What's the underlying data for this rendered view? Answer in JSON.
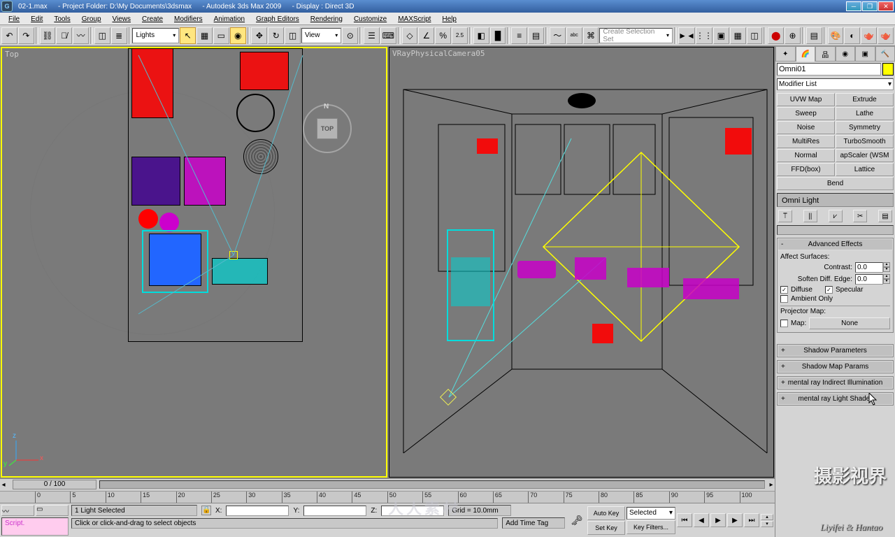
{
  "title": {
    "filename": "02-1.max",
    "project": "- Project Folder: D:\\My Documents\\3dsmax",
    "app": "- Autodesk 3ds Max  2009",
    "display": "- Display : Direct 3D"
  },
  "menu": [
    "File",
    "Edit",
    "Tools",
    "Group",
    "Views",
    "Create",
    "Modifiers",
    "Animation",
    "Graph Editors",
    "Rendering",
    "Customize",
    "MAXScript",
    "Help"
  ],
  "toolbar": {
    "category_dropdown": "Lights",
    "refcoord_dropdown": "View",
    "selection_set": "Create Selection Set"
  },
  "viewports": {
    "left_label": "Top",
    "right_label": "VRayPhysicalCamera05",
    "viewcube_face": "TOP",
    "viewcube_n": "N",
    "axis": {
      "x": "x",
      "y": "y",
      "z": "z"
    }
  },
  "cmdpanel": {
    "object_name": "Omni01",
    "modifier_list": "Modifier List",
    "mod_buttons": [
      "UVW Map",
      "Extrude",
      "Sweep",
      "Lathe",
      "Noise",
      "Symmetry",
      "MultiRes",
      "TurboSmooth",
      "Normal",
      "apScaler (WSM",
      "FFD(box)",
      "Lattice",
      "Bend"
    ],
    "stack_item": "Omni Light",
    "rollouts": {
      "adv_effects": {
        "title": "Advanced Effects",
        "affect_surfaces": "Affect Surfaces:",
        "contrast_label": "Contrast:",
        "contrast_val": "0.0",
        "soften_label": "Soften Diff. Edge:",
        "soften_val": "0.0",
        "diffuse": "Diffuse",
        "specular": "Specular",
        "ambient_only": "Ambient Only",
        "proj_map_label": "Projector Map:",
        "map_chk": "Map:",
        "map_btn": "None"
      },
      "collapsed": [
        "Shadow Parameters",
        "Shadow Map Params",
        "mental ray Indirect Illumination",
        "mental ray Light Shader"
      ]
    }
  },
  "timeline": {
    "slider": "0 / 100",
    "ticks": [
      "0",
      "5",
      "10",
      "15",
      "20",
      "25",
      "30",
      "35",
      "40",
      "45",
      "50",
      "55",
      "60",
      "65",
      "70",
      "75",
      "80",
      "85",
      "90",
      "95",
      "100"
    ]
  },
  "status": {
    "selection": "1 Light Selected",
    "lock_x": "X:",
    "lock_y": "Y:",
    "lock_z": "Z:",
    "grid": "Grid = 10.0mm",
    "prompt": "Click or click-and-drag to select objects",
    "add_time_tag": "Add Time Tag",
    "script": "Script.",
    "autokey": "Auto Key",
    "setkey": "Set Key",
    "selected": "Selected",
    "keyfilters": "Key Filters..."
  },
  "watermarks": {
    "center": "人人素材",
    "right_cn": "摄影视界",
    "right_en": "Liyifei & Hantao"
  }
}
